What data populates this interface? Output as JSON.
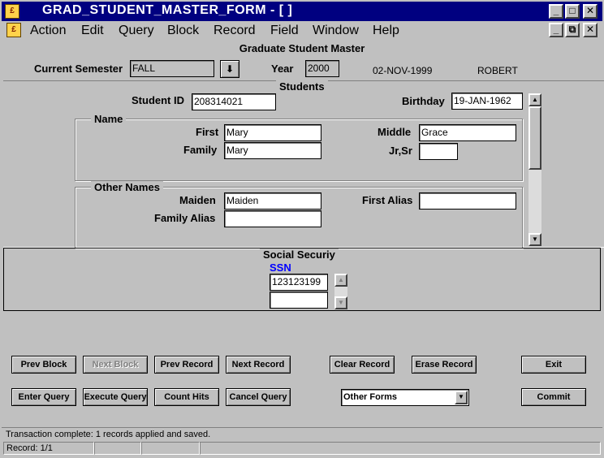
{
  "window": {
    "title": "GRAD_STUDENT_MASTER_FORM - [ ]"
  },
  "menu": [
    "Action",
    "Edit",
    "Query",
    "Block",
    "Record",
    "Field",
    "Window",
    "Help"
  ],
  "form_title": "Graduate Student Master",
  "header": {
    "semester_label": "Current Semester",
    "semester_value": "FALL",
    "year_label": "Year",
    "year_value": "2000",
    "date": "02-NOV-1999",
    "user": "ROBERT"
  },
  "students": {
    "title": "Students",
    "student_id_label": "Student ID",
    "student_id": "208314021",
    "birthday_label": "Birthday",
    "birthday": "19-JAN-1962",
    "name_group": {
      "title": "Name",
      "first_label": "First",
      "first": "Mary",
      "middle_label": "Middle",
      "middle": "Grace",
      "family_label": "Family",
      "family": "Mary",
      "suffix_label": "Jr,Sr",
      "suffix": ""
    },
    "other_names": {
      "title": "Other Names",
      "maiden_label": "Maiden",
      "maiden": "Maiden",
      "first_alias_label": "First Alias",
      "first_alias": "",
      "family_alias_label": "Family Alias",
      "family_alias": ""
    }
  },
  "social": {
    "title": "Social Securiy",
    "ssn_label": "SSN",
    "ssn_1": "123123199",
    "ssn_2": ""
  },
  "buttons": {
    "prev_block": "Prev Block",
    "next_block": "Next Block",
    "prev_record": "Prev Record",
    "next_record": "Next Record",
    "clear_record": "Clear Record",
    "erase_record": "Erase Record",
    "exit": "Exit",
    "enter_query": "Enter Query",
    "execute_query": "Execute Query",
    "count_hits": "Count Hits",
    "cancel_query": "Cancel Query",
    "other_forms": "Other Forms",
    "commit": "Commit"
  },
  "status": {
    "message": "Transaction complete: 1 records applied and saved.",
    "record": "Record: 1/1"
  },
  "colors": {
    "titlebar": "#000080",
    "ssn_label": "#0000ff",
    "window_bg": "#c0c0c0"
  },
  "icons": {
    "app": "oracle-forms-app-icon",
    "list": "dropdown-arrow-icon"
  }
}
